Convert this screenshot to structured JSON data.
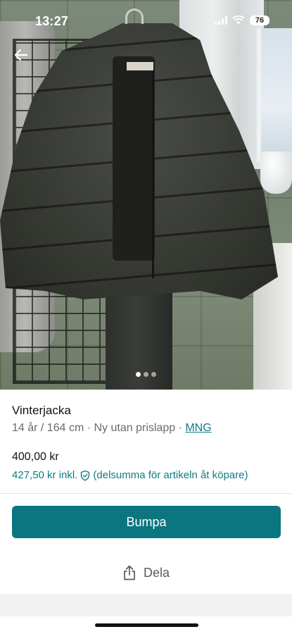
{
  "status_bar": {
    "time": "13:27",
    "battery": "76",
    "icons": [
      "signal-icon",
      "wifi-icon",
      "battery-icon"
    ]
  },
  "photo": {
    "subject": "photo of dark quilted winter jacket on hanger",
    "carousel_total": 3,
    "carousel_active": 1
  },
  "nav": {
    "back_icon": "arrow-left-icon"
  },
  "item": {
    "title": "Vinterjacka",
    "size": "14 år / 164 cm",
    "separator1": " · ",
    "condition": "Ny utan prislapp",
    "separator2": " · ",
    "brand": "MNG",
    "price": "400,00 kr",
    "price_incl": "427,50 kr inkl.",
    "price_incl_note": "(delsumma för artikeln åt köpare)",
    "price_incl_icon": "shield-check-icon"
  },
  "actions": {
    "bump_label": "Bumpa",
    "share_label": "Dela",
    "share_icon": "share-icon"
  },
  "colors": {
    "accent": "#0b7680",
    "link": "#117a87",
    "muted_text": "#6b6b6b"
  }
}
